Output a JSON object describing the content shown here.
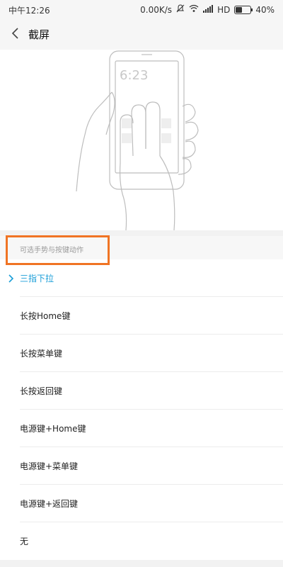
{
  "status_bar": {
    "time": "中午12:26",
    "net_speed": "0.00K/s",
    "network": "HD",
    "battery": "40%",
    "battery_level": 0.4
  },
  "header": {
    "title": "截屏",
    "back_icon": "chevron-left-icon"
  },
  "illustration": {
    "phone_time": "6:23"
  },
  "section": {
    "label": "可选手势与按键动作"
  },
  "options": [
    {
      "label": "三指下拉",
      "selected": true
    },
    {
      "label": "长按Home键",
      "selected": false
    },
    {
      "label": "长按菜单键",
      "selected": false
    },
    {
      "label": "长按返回键",
      "selected": false
    },
    {
      "label": "电源键+Home键",
      "selected": false
    },
    {
      "label": "电源键+菜单键",
      "selected": false
    },
    {
      "label": "电源键+返回键",
      "selected": false
    },
    {
      "label": "无",
      "selected": false
    }
  ],
  "colors": {
    "accent": "#1a9ed8",
    "highlight_box": "#f07424"
  }
}
